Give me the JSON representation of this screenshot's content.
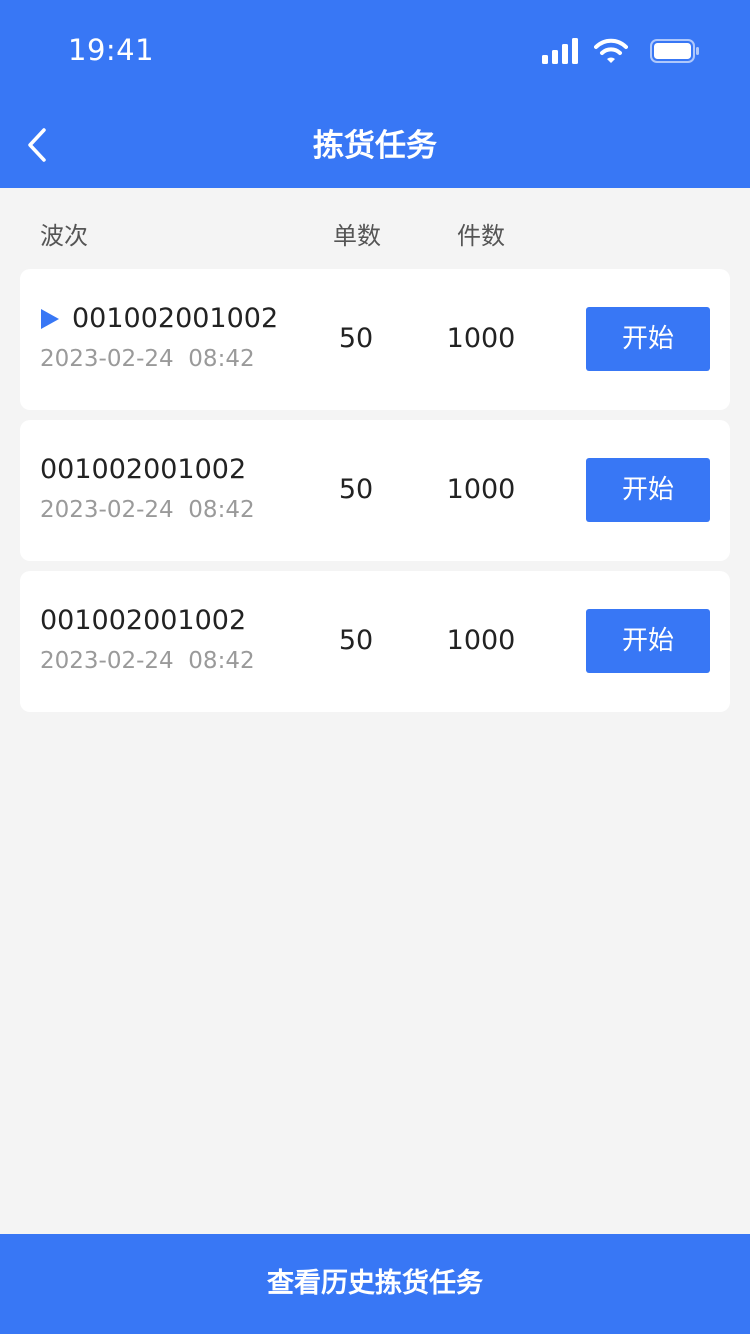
{
  "status_bar": {
    "time": "19:41",
    "icons": [
      "signal-icon",
      "wifi-icon",
      "battery-icon"
    ]
  },
  "header": {
    "title": "拣货任务",
    "back_icon": "chevron-left-icon"
  },
  "columns": {
    "wave": "波次",
    "orders": "单数",
    "items": "件数"
  },
  "tasks": [
    {
      "wave_no": "001002001002",
      "date": "2023-02-24",
      "time": "08:42",
      "orders": "50",
      "items": "1000",
      "action": "开始",
      "marker": "play-triangle-icon"
    },
    {
      "wave_no": "001002001002",
      "date": "2023-02-24",
      "time": "08:42",
      "orders": "50",
      "items": "1000",
      "action": "开始"
    },
    {
      "wave_no": "001002001002",
      "date": "2023-02-24",
      "time": "08:42",
      "orders": "50",
      "items": "1000",
      "action": "开始"
    }
  ],
  "footer": {
    "history_label": "查看历史拣货任务"
  },
  "colors": {
    "primary": "#3877f5",
    "background": "#f4f4f4",
    "card": "#ffffff",
    "text_primary": "#222222",
    "text_secondary": "#9a9a9a"
  }
}
